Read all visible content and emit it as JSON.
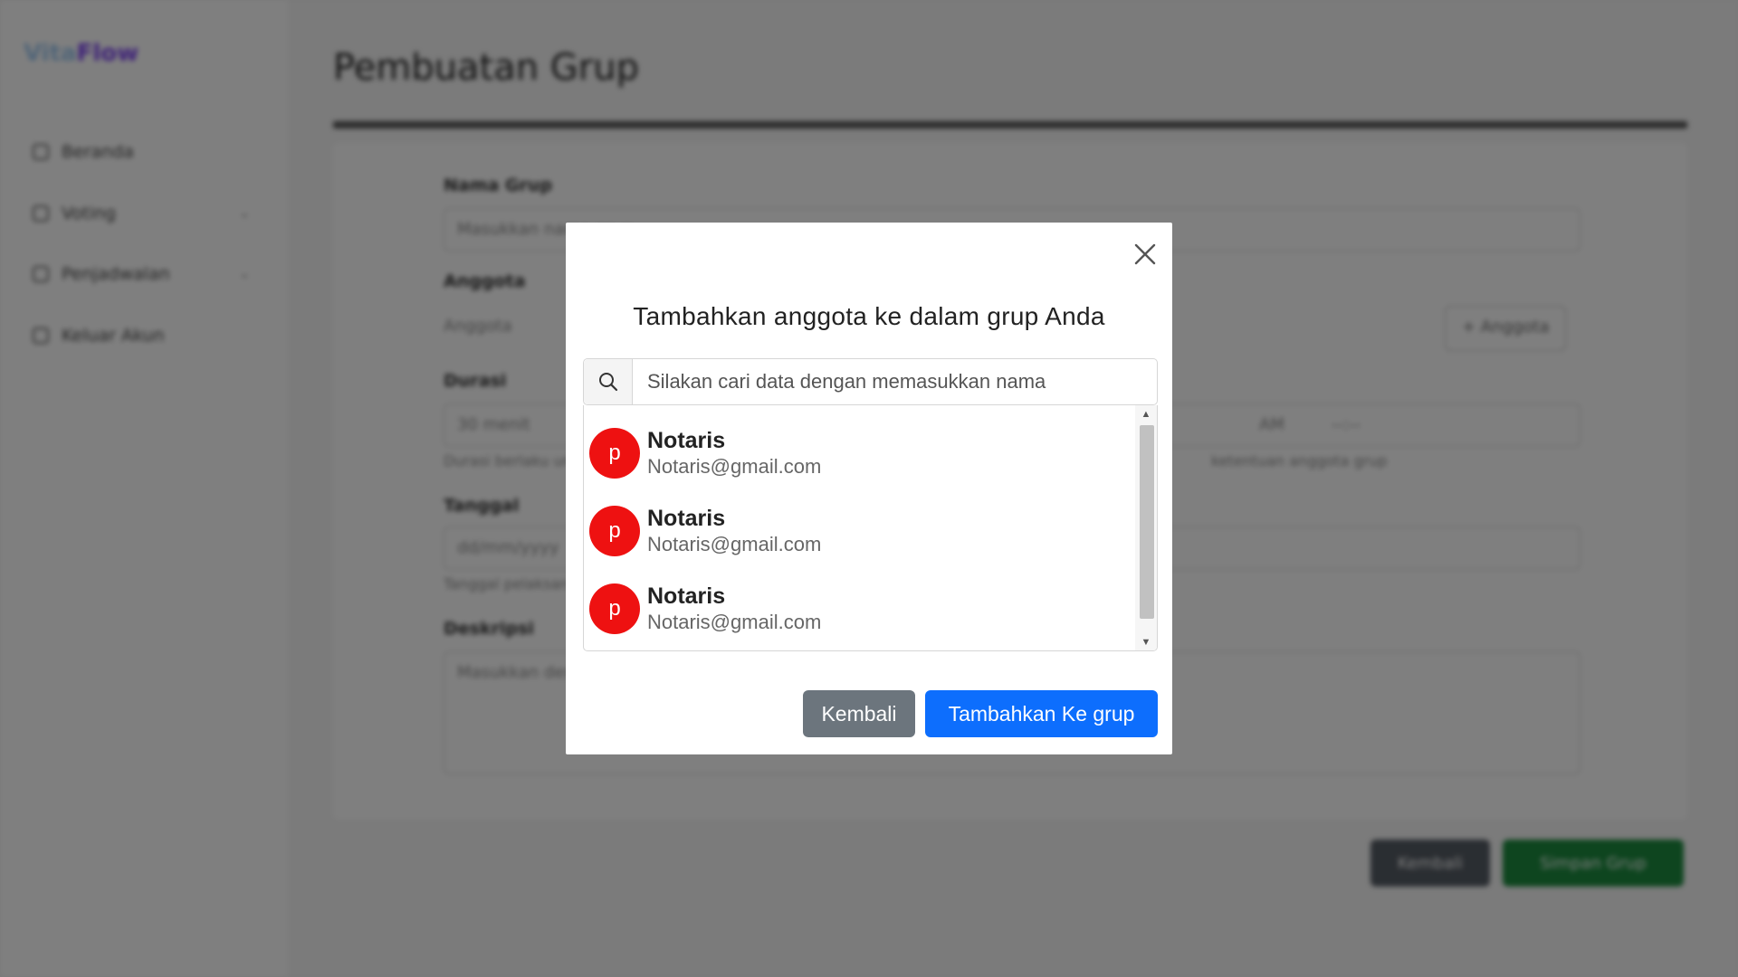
{
  "app": {
    "logo_part1": "Vita",
    "logo_part2": "Flow"
  },
  "sidebar": {
    "items": [
      {
        "label": "Beranda",
        "has_caret": false
      },
      {
        "label": "Voting",
        "has_caret": true
      },
      {
        "label": "Penjadwalan",
        "has_caret": true
      },
      {
        "label": "Keluar Akun",
        "has_caret": false
      }
    ]
  },
  "page": {
    "title": "Pembuatan Grup"
  },
  "form": {
    "group_name_label": "Nama Grup",
    "group_name_value": "Masukkan nama grup",
    "members_label": "Anggota",
    "members_placeholder": "Anggota",
    "add_member_button": "+ Anggota",
    "duration_label": "Durasi",
    "duration_value": "30 menit",
    "time_value": "AM",
    "time_placeholder": "--:--",
    "duration_help": "Durasi berlaku untuk anggota grup",
    "duration_help_right": "ketentuan anggota grup",
    "date_label": "Tanggal",
    "date_value": "dd/mm/yyyy",
    "date_help": "Tanggal pelaksanaan",
    "description_label": "Deskripsi",
    "description_placeholder": "Masukkan deskripsi"
  },
  "footer": {
    "cancel_button": "Kembali",
    "create_button": "Simpan Grup"
  },
  "modal": {
    "title": "Tambahkan anggota ke dalam grup Anda",
    "search_placeholder": "Silakan cari data dengan memasukkan nama",
    "results": [
      {
        "avatar": "p",
        "name": "Notaris",
        "email": "Notaris@gmail.com"
      },
      {
        "avatar": "p",
        "name": "Notaris",
        "email": "Notaris@gmail.com"
      },
      {
        "avatar": "p",
        "name": "Notaris",
        "email": "Notaris@gmail.com"
      }
    ],
    "back_button": "Kembali",
    "add_button": "Tambahkan Ke grup"
  },
  "colors": {
    "avatar": "#ee1111",
    "primary": "#0d6efd",
    "secondary": "#6c757d",
    "success": "#1c8a3e"
  },
  "icons": {
    "close": "close-icon",
    "search": "search-icon"
  }
}
